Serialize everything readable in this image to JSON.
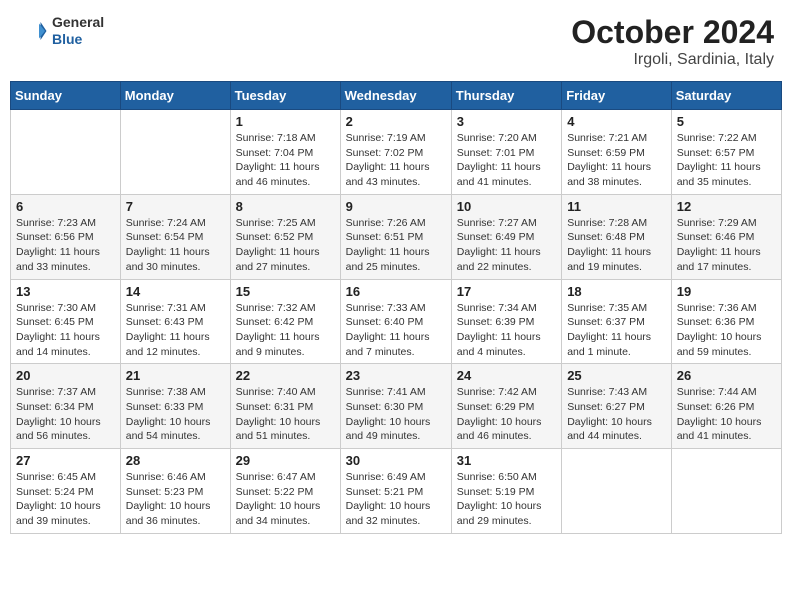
{
  "header": {
    "logo_general": "General",
    "logo_blue": "Blue",
    "month_title": "October 2024",
    "location": "Irgoli, Sardinia, Italy"
  },
  "days_of_week": [
    "Sunday",
    "Monday",
    "Tuesday",
    "Wednesday",
    "Thursday",
    "Friday",
    "Saturday"
  ],
  "weeks": [
    [
      {
        "day": "",
        "info": ""
      },
      {
        "day": "",
        "info": ""
      },
      {
        "day": "1",
        "info": "Sunrise: 7:18 AM\nSunset: 7:04 PM\nDaylight: 11 hours and 46 minutes."
      },
      {
        "day": "2",
        "info": "Sunrise: 7:19 AM\nSunset: 7:02 PM\nDaylight: 11 hours and 43 minutes."
      },
      {
        "day": "3",
        "info": "Sunrise: 7:20 AM\nSunset: 7:01 PM\nDaylight: 11 hours and 41 minutes."
      },
      {
        "day": "4",
        "info": "Sunrise: 7:21 AM\nSunset: 6:59 PM\nDaylight: 11 hours and 38 minutes."
      },
      {
        "day": "5",
        "info": "Sunrise: 7:22 AM\nSunset: 6:57 PM\nDaylight: 11 hours and 35 minutes."
      }
    ],
    [
      {
        "day": "6",
        "info": "Sunrise: 7:23 AM\nSunset: 6:56 PM\nDaylight: 11 hours and 33 minutes."
      },
      {
        "day": "7",
        "info": "Sunrise: 7:24 AM\nSunset: 6:54 PM\nDaylight: 11 hours and 30 minutes."
      },
      {
        "day": "8",
        "info": "Sunrise: 7:25 AM\nSunset: 6:52 PM\nDaylight: 11 hours and 27 minutes."
      },
      {
        "day": "9",
        "info": "Sunrise: 7:26 AM\nSunset: 6:51 PM\nDaylight: 11 hours and 25 minutes."
      },
      {
        "day": "10",
        "info": "Sunrise: 7:27 AM\nSunset: 6:49 PM\nDaylight: 11 hours and 22 minutes."
      },
      {
        "day": "11",
        "info": "Sunrise: 7:28 AM\nSunset: 6:48 PM\nDaylight: 11 hours and 19 minutes."
      },
      {
        "day": "12",
        "info": "Sunrise: 7:29 AM\nSunset: 6:46 PM\nDaylight: 11 hours and 17 minutes."
      }
    ],
    [
      {
        "day": "13",
        "info": "Sunrise: 7:30 AM\nSunset: 6:45 PM\nDaylight: 11 hours and 14 minutes."
      },
      {
        "day": "14",
        "info": "Sunrise: 7:31 AM\nSunset: 6:43 PM\nDaylight: 11 hours and 12 minutes."
      },
      {
        "day": "15",
        "info": "Sunrise: 7:32 AM\nSunset: 6:42 PM\nDaylight: 11 hours and 9 minutes."
      },
      {
        "day": "16",
        "info": "Sunrise: 7:33 AM\nSunset: 6:40 PM\nDaylight: 11 hours and 7 minutes."
      },
      {
        "day": "17",
        "info": "Sunrise: 7:34 AM\nSunset: 6:39 PM\nDaylight: 11 hours and 4 minutes."
      },
      {
        "day": "18",
        "info": "Sunrise: 7:35 AM\nSunset: 6:37 PM\nDaylight: 11 hours and 1 minute."
      },
      {
        "day": "19",
        "info": "Sunrise: 7:36 AM\nSunset: 6:36 PM\nDaylight: 10 hours and 59 minutes."
      }
    ],
    [
      {
        "day": "20",
        "info": "Sunrise: 7:37 AM\nSunset: 6:34 PM\nDaylight: 10 hours and 56 minutes."
      },
      {
        "day": "21",
        "info": "Sunrise: 7:38 AM\nSunset: 6:33 PM\nDaylight: 10 hours and 54 minutes."
      },
      {
        "day": "22",
        "info": "Sunrise: 7:40 AM\nSunset: 6:31 PM\nDaylight: 10 hours and 51 minutes."
      },
      {
        "day": "23",
        "info": "Sunrise: 7:41 AM\nSunset: 6:30 PM\nDaylight: 10 hours and 49 minutes."
      },
      {
        "day": "24",
        "info": "Sunrise: 7:42 AM\nSunset: 6:29 PM\nDaylight: 10 hours and 46 minutes."
      },
      {
        "day": "25",
        "info": "Sunrise: 7:43 AM\nSunset: 6:27 PM\nDaylight: 10 hours and 44 minutes."
      },
      {
        "day": "26",
        "info": "Sunrise: 7:44 AM\nSunset: 6:26 PM\nDaylight: 10 hours and 41 minutes."
      }
    ],
    [
      {
        "day": "27",
        "info": "Sunrise: 6:45 AM\nSunset: 5:24 PM\nDaylight: 10 hours and 39 minutes."
      },
      {
        "day": "28",
        "info": "Sunrise: 6:46 AM\nSunset: 5:23 PM\nDaylight: 10 hours and 36 minutes."
      },
      {
        "day": "29",
        "info": "Sunrise: 6:47 AM\nSunset: 5:22 PM\nDaylight: 10 hours and 34 minutes."
      },
      {
        "day": "30",
        "info": "Sunrise: 6:49 AM\nSunset: 5:21 PM\nDaylight: 10 hours and 32 minutes."
      },
      {
        "day": "31",
        "info": "Sunrise: 6:50 AM\nSunset: 5:19 PM\nDaylight: 10 hours and 29 minutes."
      },
      {
        "day": "",
        "info": ""
      },
      {
        "day": "",
        "info": ""
      }
    ]
  ]
}
